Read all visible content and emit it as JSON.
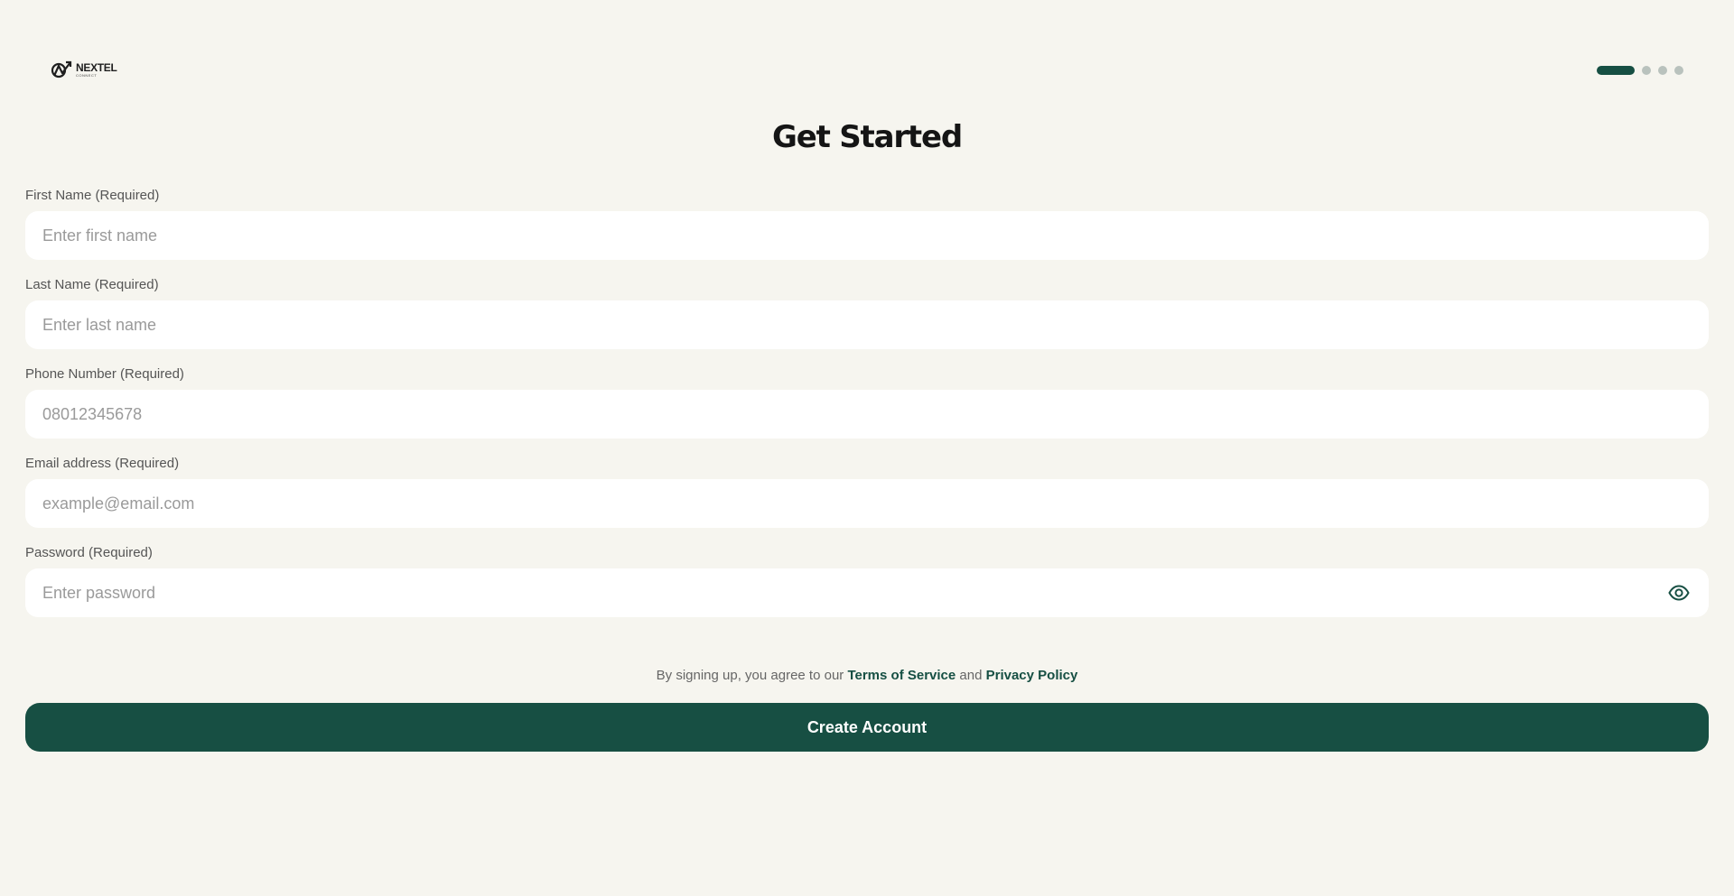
{
  "brand": {
    "name": "NEXTEL",
    "sub": "CONNECT",
    "logo_icon": "nextel-logo-icon"
  },
  "progress": {
    "current_step": 1,
    "total_steps": 4
  },
  "page": {
    "title": "Get Started"
  },
  "form": {
    "fields": [
      {
        "label": "First Name (Required)",
        "placeholder": "Enter first name",
        "value": ""
      },
      {
        "label": "Last Name (Required)",
        "placeholder": "Enter last name",
        "value": ""
      },
      {
        "label": "Phone Number (Required)",
        "placeholder": "08012345678",
        "value": ""
      },
      {
        "label": "Email address (Required)",
        "placeholder": "example@email.com",
        "value": ""
      },
      {
        "label": "Password (Required)",
        "placeholder": "Enter password",
        "value": "",
        "toggle_icon": "eye-icon"
      }
    ],
    "terms": {
      "prefix": "By signing up, you agree to our ",
      "terms_link": "Terms of Service",
      "conjunction": " and ",
      "privacy_link": "Privacy Policy"
    },
    "submit_label": "Create Account"
  },
  "colors": {
    "background": "#f6f5ef",
    "primary": "#174f43",
    "input_background": "#ffffff",
    "inactive_dot": "#b9c2bd"
  }
}
